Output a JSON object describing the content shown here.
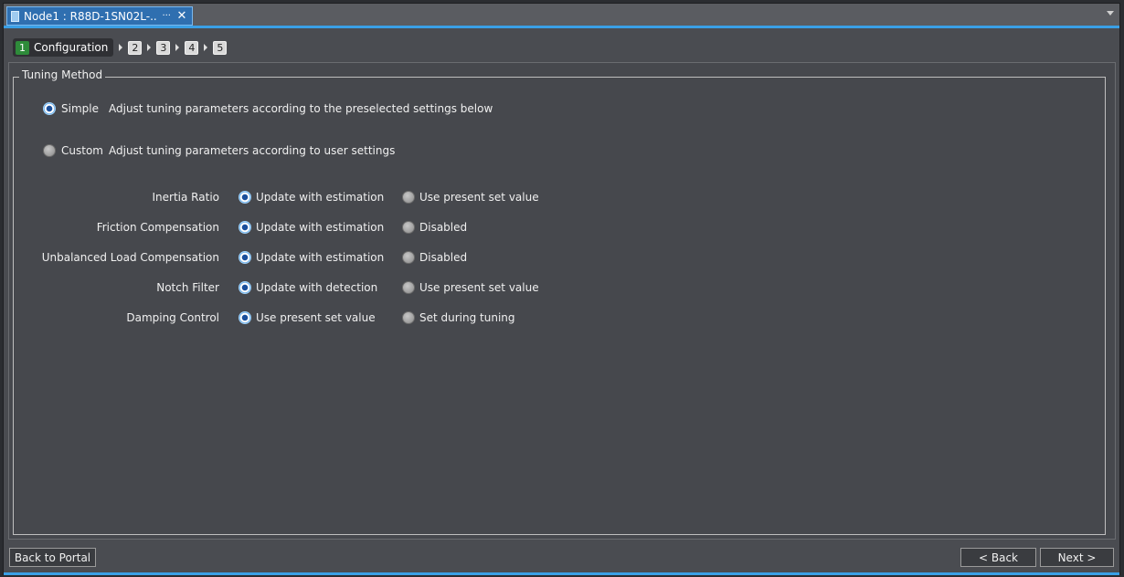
{
  "tab": {
    "title": "Node1 : R88D-1SN02L-...",
    "more_glyph": "···",
    "close_glyph": "✕"
  },
  "wizard": {
    "active_step": {
      "number": "1",
      "label": "Configuration"
    },
    "steps": [
      "2",
      "3",
      "4",
      "5"
    ]
  },
  "tuning_method": {
    "title": "Tuning Method",
    "simple": {
      "label": "Simple",
      "description": "Adjust tuning parameters according to the preselected settings below",
      "selected": true
    },
    "custom": {
      "label": "Custom",
      "description": "Adjust tuning parameters according to user settings",
      "selected": false
    }
  },
  "params": [
    {
      "label": "Inertia Ratio",
      "option1": "Update with estimation",
      "option2": "Use present set value",
      "selected": 1
    },
    {
      "label": "Friction Compensation",
      "option1": "Update with estimation",
      "option2": "Disabled",
      "selected": 1
    },
    {
      "label": "Unbalanced Load Compensation",
      "option1": "Update with estimation",
      "option2": "Disabled",
      "selected": 1
    },
    {
      "label": "Notch Filter",
      "option1": "Update with detection",
      "option2": "Use present set value",
      "selected": 1
    },
    {
      "label": "Damping Control",
      "option1": "Use present set value",
      "option2": "Set during tuning",
      "selected": 1
    }
  ],
  "footer": {
    "back_to_portal": "Back to Portal",
    "back": "< Back",
    "next": "Next >"
  },
  "colors": {
    "accent": "#3aa0e6",
    "step_active": "#2e8b3a",
    "radio_selected": "#1a4f9c"
  }
}
